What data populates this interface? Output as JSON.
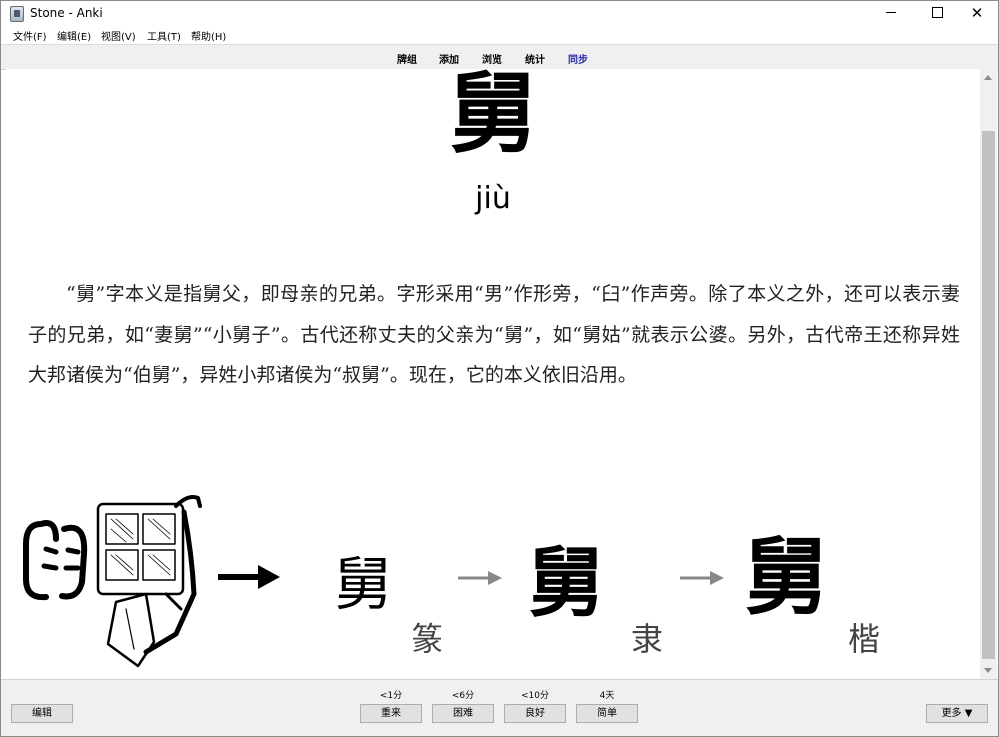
{
  "window": {
    "title": "Stone - Anki"
  },
  "menu": [
    "文件(F)",
    "编辑(E)",
    "视图(V)",
    "工具(T)",
    "帮助(H)"
  ],
  "toolbar": {
    "decks": "牌组",
    "add": "添加",
    "browse": "浏览",
    "stats": "统计",
    "sync": "同步"
  },
  "card": {
    "character": "舅",
    "pinyin": "jiù",
    "definition": "“舅”字本义是指舅父，即母亲的兄弟。字形采用“男”作形旁，“臼”作声旁。除了本义之外，还可以表示妻子的兄弟，如“妻舅”“小舅子”。古代还称丈夫的父亲为“舅”，如“舅姑”就表示公婆。另外，古代帝王还称异姓大邦诸侯为“伯舅”，异姓小邦诸侯为“叔舅”。现在，它的本义依旧沿用。",
    "evolution": [
      {
        "char": "舅",
        "label": "篆"
      },
      {
        "char": "舅",
        "label": "隶"
      },
      {
        "char": "舅",
        "label": "楷"
      }
    ]
  },
  "bottom": {
    "edit": "编辑",
    "more": "更多 ▼",
    "answers": [
      {
        "label": "重来",
        "interval": "<1分"
      },
      {
        "label": "困难",
        "interval": "<6分"
      },
      {
        "label": "良好",
        "interval": "<10分"
      },
      {
        "label": "简单",
        "interval": "4天"
      }
    ]
  }
}
